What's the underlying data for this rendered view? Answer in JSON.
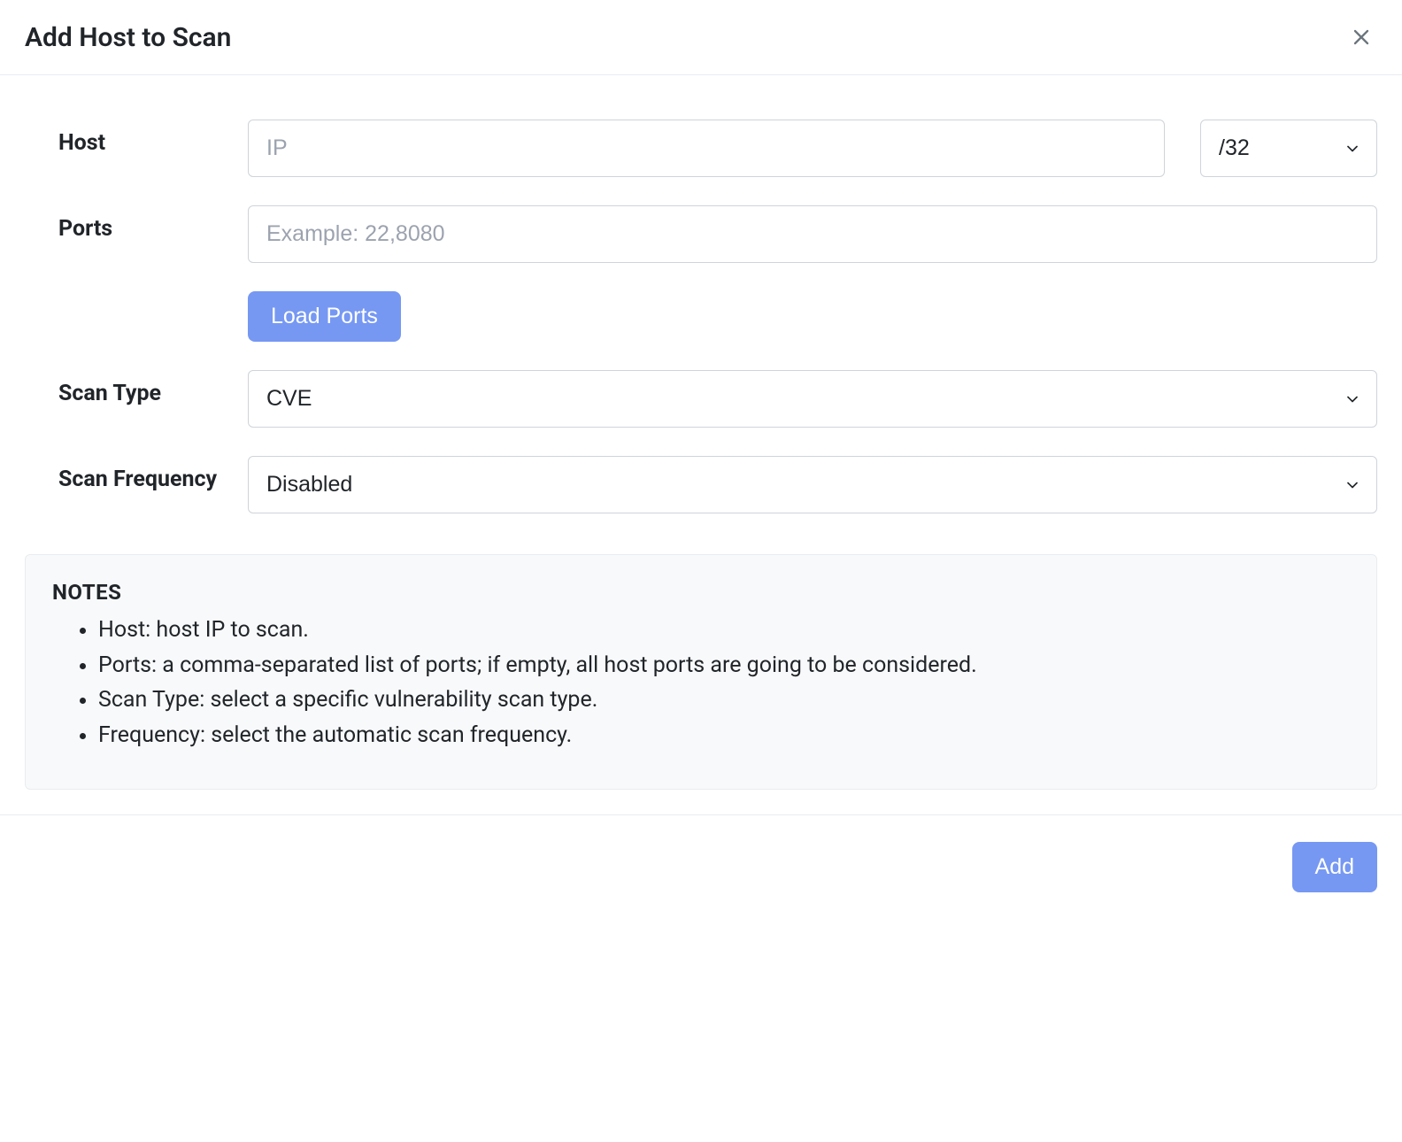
{
  "header": {
    "title": "Add Host to Scan"
  },
  "form": {
    "host": {
      "label": "Host",
      "placeholder": "IP",
      "value": "",
      "cidr_value": "/32"
    },
    "ports": {
      "label": "Ports",
      "placeholder": "Example: 22,8080",
      "value": ""
    },
    "load_ports_label": "Load Ports",
    "scan_type": {
      "label": "Scan Type",
      "value": "CVE"
    },
    "scan_frequency": {
      "label": "Scan Frequency",
      "value": "Disabled"
    }
  },
  "notes": {
    "title": "NOTES",
    "items": [
      "Host: host IP to scan.",
      "Ports: a comma-separated list of ports; if empty, all host ports are going to be considered.",
      "Scan Type: select a specific vulnerability scan type.",
      "Frequency: select the automatic scan frequency."
    ]
  },
  "footer": {
    "add_label": "Add"
  }
}
